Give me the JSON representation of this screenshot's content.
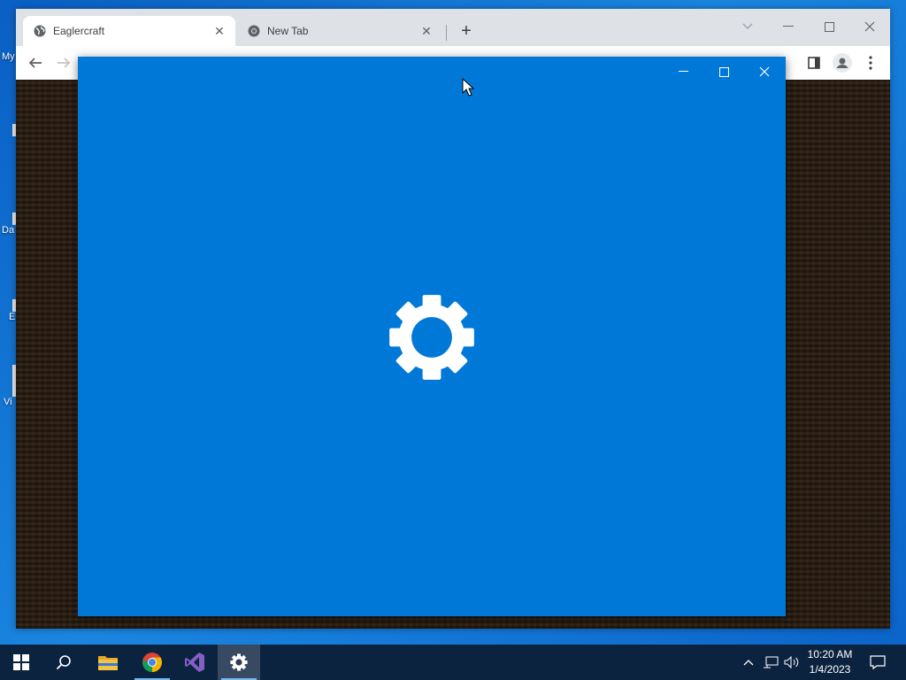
{
  "desktop": {
    "icons": [
      {
        "caption": "My"
      },
      {
        "caption": "Da"
      },
      {
        "caption": "E"
      },
      {
        "caption": "Vi"
      }
    ]
  },
  "browser": {
    "tabs": [
      {
        "title": "Eaglercraft",
        "favicon": "globe-icon",
        "active": true
      },
      {
        "title": "New Tab",
        "favicon": "chrome-icon",
        "active": false
      }
    ]
  },
  "settings_window": {
    "icon": "gear-icon",
    "background": "#0078d7"
  },
  "taskbar": {
    "apps": [
      "start",
      "search",
      "file-explorer",
      "chrome",
      "visual-studio",
      "settings"
    ],
    "active_app": "settings",
    "clock": {
      "time": "10:20 AM",
      "date": "1/4/2023"
    },
    "color": "#0c2340"
  }
}
